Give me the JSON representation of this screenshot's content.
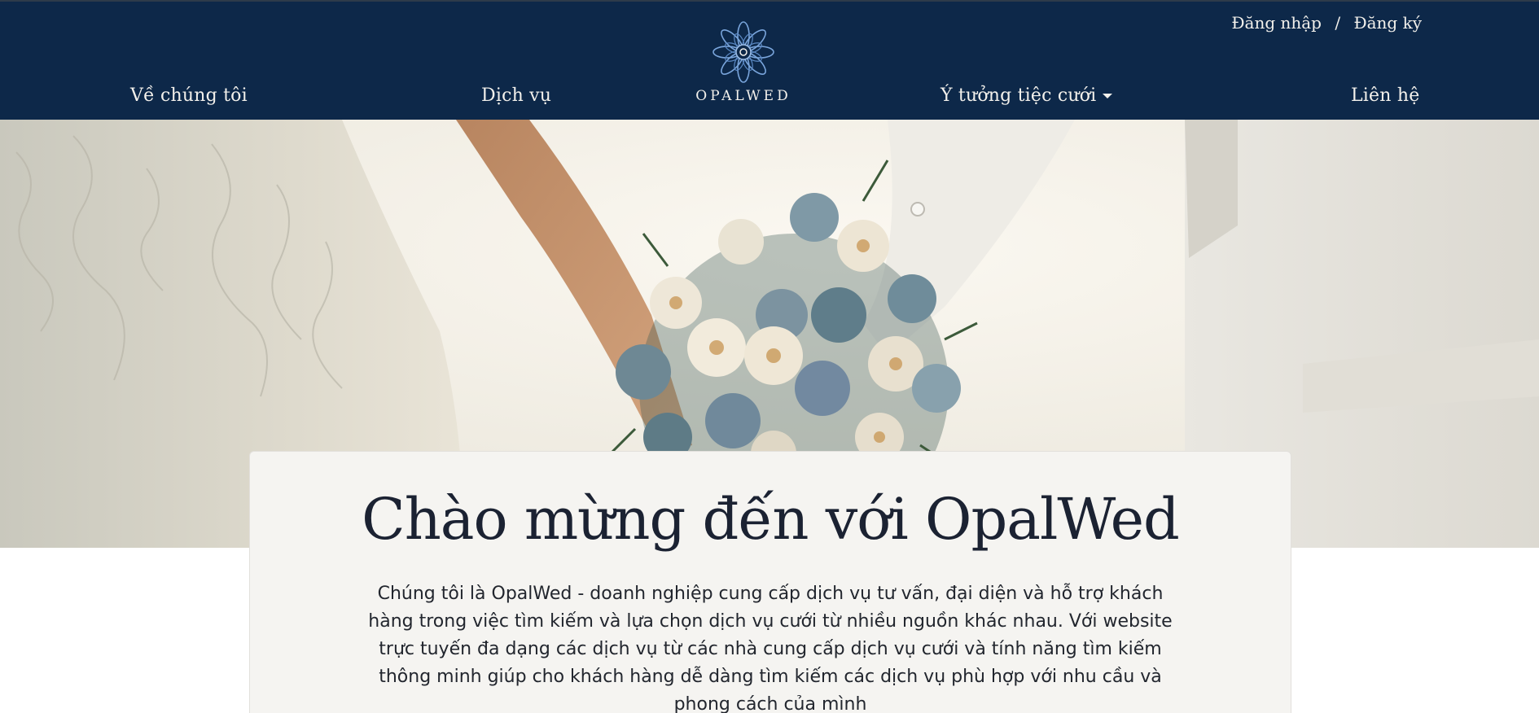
{
  "header": {
    "login_label": "Đăng nhập",
    "separator": "/",
    "register_label": "Đăng ký",
    "logo_text": "OPALWED",
    "nav": {
      "about": "Về chúng tôi",
      "services": "Dịch vụ",
      "ideas": "Ý tưởng tiệc cưới",
      "contact": "Liên hệ"
    },
    "icons": {
      "logo": "lotus-logo-icon",
      "dropdown": "caret-down-icon"
    }
  },
  "hero": {
    "image": "wedding-couple-holding-bouquet"
  },
  "welcome": {
    "title": "Chào mừng đến với OpalWed",
    "description": "Chúng tôi là OpalWed - doanh nghiệp cung cấp dịch vụ tư vấn, đại diện và hỗ trợ khách hàng trong việc tìm kiếm và lựa chọn dịch vụ cưới từ nhiều nguồn khác nhau. Với website trực tuyến đa dạng các dịch vụ từ các nhà cung cấp dịch vụ cưới và tính năng tìm kiếm thông minh giúp cho khách hàng dễ dàng tìm kiếm các dịch vụ phù hợp với nhu cầu và phong cách của mình"
  },
  "colors": {
    "header_bg": "#0d2849",
    "header_text": "#f3f1ec",
    "logo_blue": "#6f9fd8",
    "card_bg": "#f5f4f1",
    "title_text": "#1b2232"
  }
}
